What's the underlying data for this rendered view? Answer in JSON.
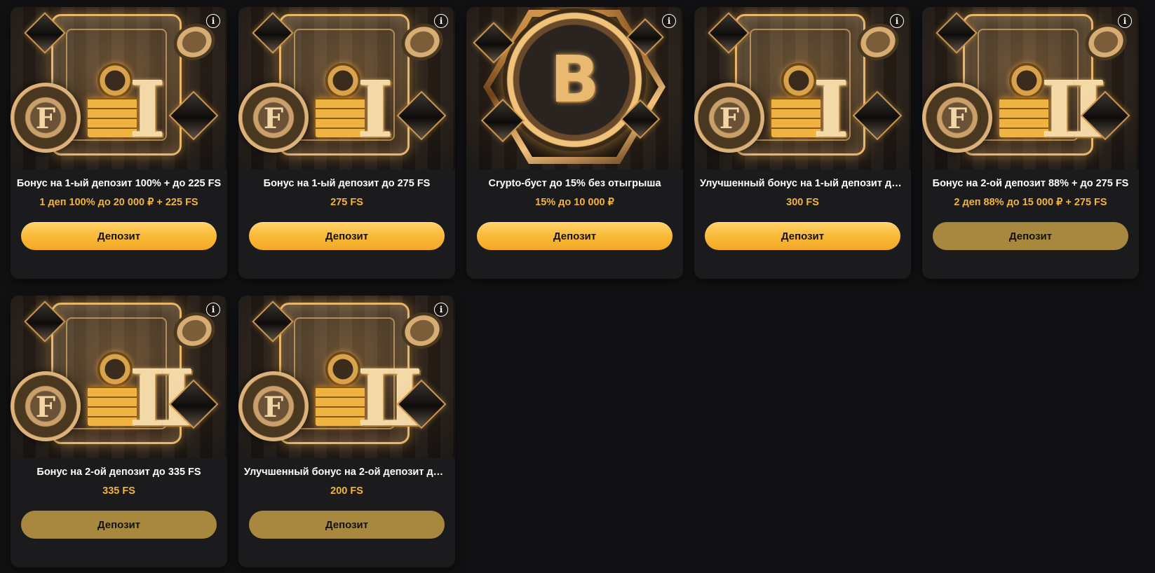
{
  "colors": {
    "page_bg": "#111113",
    "card_bg": "#1b1b1e",
    "title": "#ffffff",
    "accent": "#f2b43c",
    "button_active": "#f9b834",
    "button_dim": "#a8883e"
  },
  "cards": [
    {
      "title": "Бонус на 1-ый депозит 100% + до 225 FS",
      "subtitle": "1 деп 100% до 20 000 ₽ + 225 FS",
      "button": "Депозит",
      "button_state": "active",
      "art": "vault-I",
      "numeral": "I",
      "info_icon": "info-icon"
    },
    {
      "title": "Бонус на 1-ый депозит до 275 FS",
      "subtitle": "275 FS",
      "button": "Депозит",
      "button_state": "active",
      "art": "vault-I",
      "numeral": "I",
      "info_icon": "info-icon"
    },
    {
      "title": "Crypto-буст до 15% без отыгрыша",
      "subtitle": "15% до 10 000 ₽",
      "button": "Депозит",
      "button_state": "active",
      "art": "bitcoin",
      "numeral": "B",
      "info_icon": "info-icon"
    },
    {
      "title": "Улучшенный бонус на 1-ый депозит до ...",
      "subtitle": "300 FS",
      "button": "Депозит",
      "button_state": "active",
      "art": "vault-I",
      "numeral": "I",
      "info_icon": "info-icon"
    },
    {
      "title": "Бонус на 2-ой депозит 88% + до 275 FS",
      "subtitle": "2 деп 88% до 15 000 ₽ + 275 FS",
      "button": "Депозит",
      "button_state": "dim",
      "art": "vault-II",
      "numeral": "II",
      "info_icon": "info-icon"
    },
    {
      "title": "Бонус на 2-ой депозит до 335 FS",
      "subtitle": "335 FS",
      "button": "Депозит",
      "button_state": "dim",
      "art": "vault-II",
      "numeral": "II",
      "info_icon": "info-icon"
    },
    {
      "title": "Улучшенный бонус на 2-ой депозит до ...",
      "subtitle": "200 FS",
      "button": "Депозит",
      "button_state": "dim",
      "art": "vault-II",
      "numeral": "II",
      "info_icon": "info-icon"
    }
  ],
  "info_glyph": "i"
}
